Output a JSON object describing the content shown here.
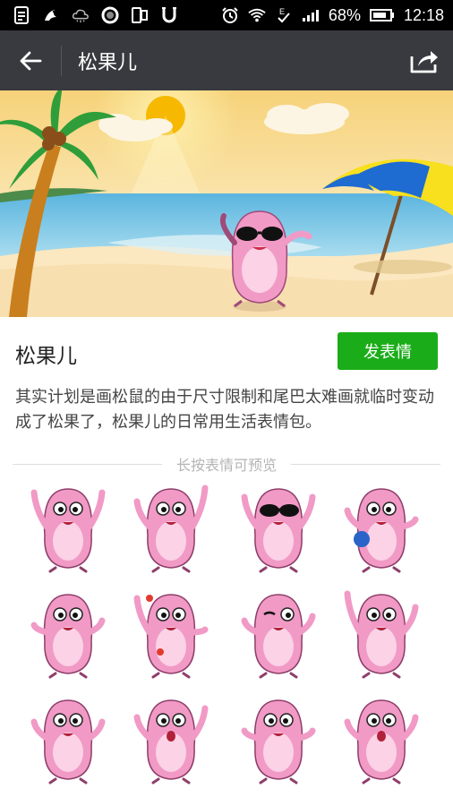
{
  "status_bar": {
    "battery_percent": "68%",
    "time": "12:18",
    "left_icons": [
      "document-icon",
      "bird-icon",
      "cloud-icon",
      "circle-icon",
      "tablet-icon",
      "u-icon"
    ],
    "right_icons": [
      "alarm-icon",
      "wifi-icon",
      "data-check-icon",
      "signal-icon",
      "battery-icon"
    ]
  },
  "app_bar": {
    "title": "松果儿",
    "back_icon": "arrow-left-icon",
    "share_icon": "share-icon"
  },
  "banner": {
    "description": "beach scene with palm tree, sun and umbrella"
  },
  "pack": {
    "title": "松果儿",
    "send_label": "发表情",
    "description": "其实计划是画松鼠的由于尺寸限制和尾巴太难画就临时变动成了松果了，松果儿的日常用生活表情包。"
  },
  "hint": "长按表情可预览",
  "colors": {
    "status_bar": "#000000",
    "app_bar": "#393a3f",
    "accent_green": "#1aad19",
    "character_pink": "#f19ac6"
  },
  "stickers": [
    {
      "name": "sticker-wave"
    },
    {
      "name": "sticker-cheer"
    },
    {
      "name": "sticker-sunglasses"
    },
    {
      "name": "sticker-holding-ball"
    },
    {
      "name": "sticker-thinking"
    },
    {
      "name": "sticker-flowers"
    },
    {
      "name": "sticker-wink"
    },
    {
      "name": "sticker-pointing"
    },
    {
      "name": "sticker-shrug"
    },
    {
      "name": "sticker-surprised"
    },
    {
      "name": "sticker-thumbs-up"
    },
    {
      "name": "sticker-worried"
    }
  ]
}
